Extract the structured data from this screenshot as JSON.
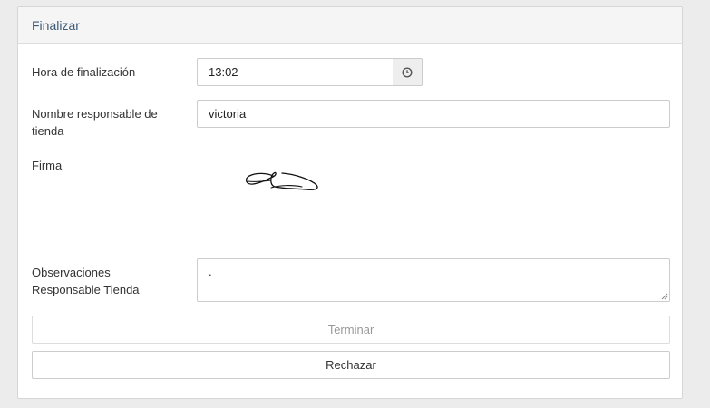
{
  "panel": {
    "title": "Finalizar"
  },
  "form": {
    "end_time_label": "Hora de finalización",
    "end_time_value": "13:02",
    "responsible_name_label": "Nombre responsable de tienda",
    "responsible_name_value": "victoria",
    "signature_label": "Firma",
    "observations_label": "Observaciones Responsable Tienda",
    "observations_value": "."
  },
  "buttons": {
    "finish_label": "Terminar",
    "finish_disabled": true,
    "reject_label": "Rechazar"
  },
  "icons": {
    "time": "clock-icon",
    "resize": "resize-handle-icon"
  }
}
